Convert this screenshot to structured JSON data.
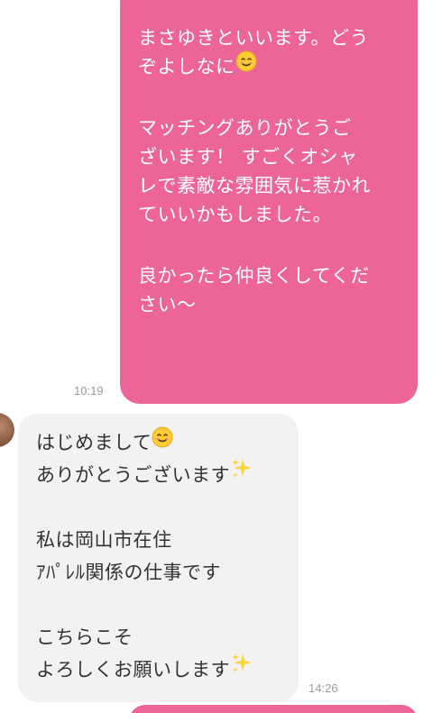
{
  "conversation": {
    "outgoing": {
      "lines": [
        {
          "text": "まさゆきといいます。どう"
        },
        {
          "text": "ぞよしなに",
          "emoji": "smiling-face-emoji"
        },
        {
          "text": ""
        },
        {
          "text": "マッチングありがとうご"
        },
        {
          "text": "ざいます！ すごくオシャ"
        },
        {
          "text": "レで素敵な雰囲気に惹かれ"
        },
        {
          "text": "ていいかもしました。"
        },
        {
          "text": ""
        },
        {
          "text": "良かったら仲良くしてくだ"
        },
        {
          "text": "さい〜"
        }
      ],
      "time": "10:19"
    },
    "incoming": {
      "lines": [
        {
          "text": "はじめまして",
          "emoji": "smiling-face-emoji"
        },
        {
          "text": "ありがとうございます",
          "emoji": "sparkles-emoji"
        },
        {
          "text": ""
        },
        {
          "text": "私は岡山市在住"
        },
        {
          "text": "ｱﾊﾟﾚﾙ関係の仕事です"
        },
        {
          "text": ""
        },
        {
          "text": "こちらこそ"
        },
        {
          "text": "よろしくお願いします",
          "emoji": "sparkles-emoji"
        }
      ],
      "time": "14:26"
    }
  },
  "colors": {
    "outgoing_bubble": "#ec6498",
    "incoming_bubble": "#f2f2f2",
    "timestamp": "#9a9a9a"
  }
}
